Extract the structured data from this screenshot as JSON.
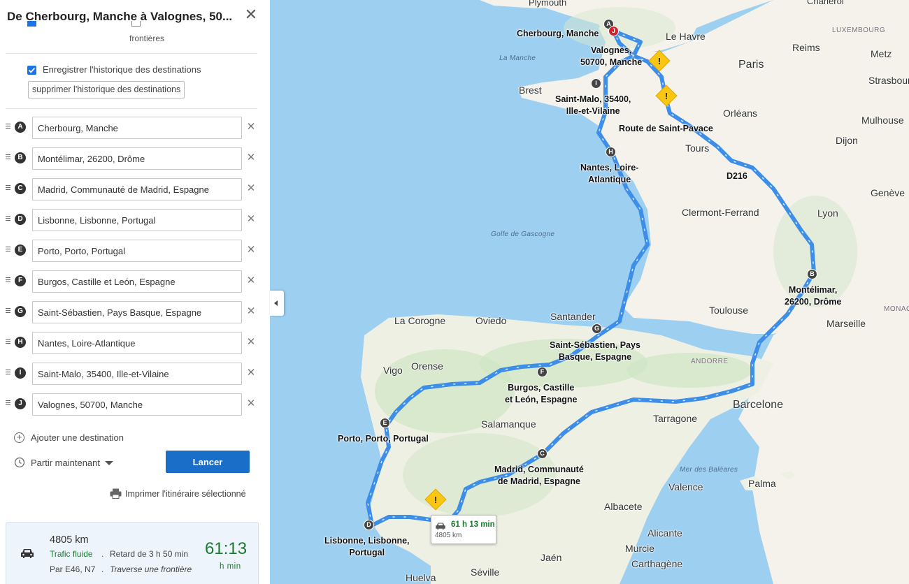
{
  "sidebar": {
    "title": "De Cherbourg, Manche à Valognes, 50...",
    "partial_option_label": "frontières",
    "history": {
      "label": "Enregistrer l'historique des destinations",
      "clear_button": "supprimer l'historique des destinations"
    },
    "stops": [
      {
        "letter": "A",
        "value": "Cherbourg, Manche"
      },
      {
        "letter": "B",
        "value": "Montélimar, 26200, Drôme"
      },
      {
        "letter": "C",
        "value": "Madrid, Communauté de Madrid, Espagne"
      },
      {
        "letter": "D",
        "value": "Lisbonne, Lisbonne, Portugal"
      },
      {
        "letter": "E",
        "value": "Porto, Porto, Portugal"
      },
      {
        "letter": "F",
        "value": "Burgos, Castille et León, Espagne"
      },
      {
        "letter": "G",
        "value": "Saint-Sébastien, Pays Basque, Espagne"
      },
      {
        "letter": "H",
        "value": "Nantes, Loire-Atlantique"
      },
      {
        "letter": "I",
        "value": "Saint-Malo, 35400, Ille-et-Vilaine"
      },
      {
        "letter": "J",
        "value": "Valognes, 50700, Manche"
      }
    ],
    "add_destination": "Ajouter une destination",
    "depart": "Partir maintenant",
    "launch": "Lancer",
    "print": "Imprimer l'itinéraire sélectionné",
    "route": {
      "distance": "4805 km",
      "traffic": "Trafic fluide",
      "delay": "Retard de 3 h 50 min",
      "via": "Par E46, N7",
      "border": "Traverse une frontière",
      "time": "61:13",
      "time_units": "h  min"
    }
  },
  "map": {
    "places": {
      "plymouth": "Plymouth",
      "cherbourg": "Cherbourg, Manche",
      "le_havre": "Le Havre",
      "valognes": "Valognes,\n50700, Manche",
      "paris": "Paris",
      "reims": "Reims",
      "metz": "Metz",
      "luxembourg": "LUXEMBOURG",
      "strasbourg": "Strasbourg",
      "brest": "Brest",
      "saint_malo": "Saint-Malo, 35400,\nIlle-et-Vilaine",
      "orleans": "Orléans",
      "mulhouse": "Mulhouse",
      "route_saint_pavace": "Route de Saint-Pavace",
      "tours": "Tours",
      "dijon": "Dijon",
      "nantes": "Nantes, Loire-\nAtlantique",
      "d216": "D216",
      "geneve": "Genève",
      "clermont": "Clermont-Ferrand",
      "lyon": "Lyon",
      "montelimar": "Montélimar,\n26200, Drôme",
      "toulouse": "Toulouse",
      "marseille": "Marseille",
      "monaco": "MONAC",
      "la_corogne": "La Corogne",
      "oviedo": "Oviedo",
      "santander": "Santander",
      "saint_sebastien": "Saint-Sébastien, Pays\nBasque, Espagne",
      "vigo": "Vigo",
      "orense": "Orense",
      "andorre": "ANDORRE",
      "burgos": "Burgos, Castille\net León, Espagne",
      "barcelone": "Barcelone",
      "salamanque": "Salamanque",
      "tarragone": "Tarragone",
      "porto": "Porto, Porto, Portugal",
      "madrid": "Madrid, Communauté\nde Madrid, Espagne",
      "valence": "Valence",
      "palma": "Palma",
      "albacete": "Albacete",
      "alicante": "Alicante",
      "lisbonne": "Lisbonne, Lisbonne,\nPortugal",
      "murcie": "Murcie",
      "jaen": "Jaén",
      "carthagene": "Carthagène",
      "seville": "Séville",
      "huelva": "Huelva",
      "charleroi": "Charleroi"
    },
    "seas": {
      "la_manche": "La Manche",
      "golfe": "Golfe de Gascogne",
      "baleares": "Mer des Baléares"
    },
    "bubble": {
      "time": "61 h 13 min",
      "distance": "4805 km"
    },
    "warning_symbol": "!"
  },
  "colors": {
    "route": "#3d8ee8",
    "accent": "#1a73e8",
    "traffic_green": "#1b7a2e",
    "water": "#9dcff0",
    "land": "#f4f2ea"
  }
}
